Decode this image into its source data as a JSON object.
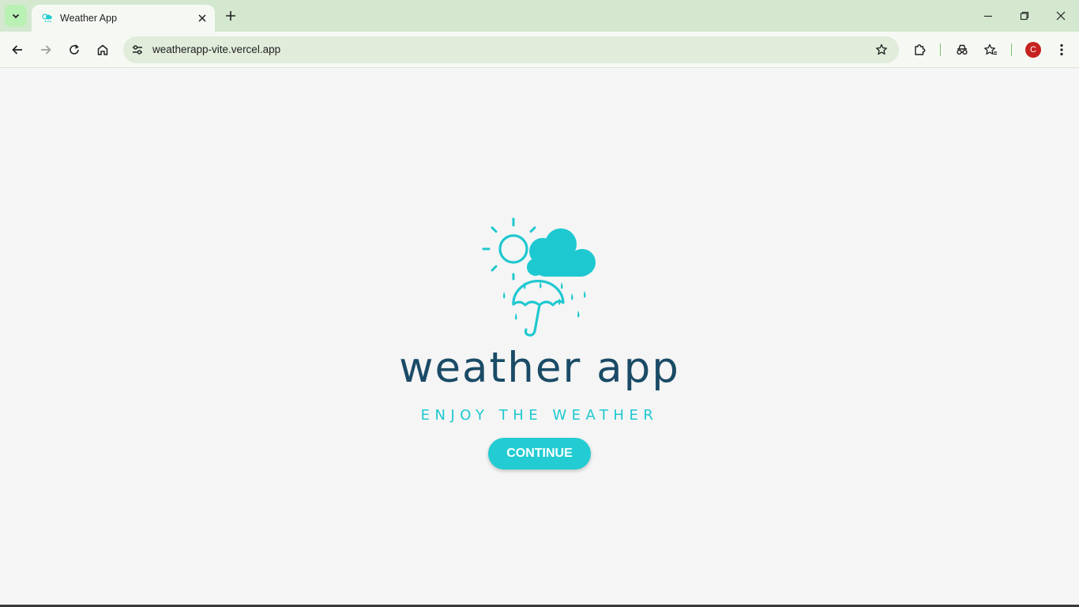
{
  "browser": {
    "tab_title": "Weather App",
    "url": "weatherapp-vite.vercel.app",
    "profile_initial": "C"
  },
  "page": {
    "title": "weather app",
    "tagline": "ENJOY THE WEATHER",
    "continue_label": "CONTINUE"
  },
  "colors": {
    "accent": "#22ccd2",
    "title": "#1a4b66",
    "tabstrip": "#d3e8cf",
    "toolbar": "#f6f9f3",
    "omnibox": "#e1ecdb",
    "page_bg": "#f5f5f5"
  },
  "icons": {
    "tab_search": "chevron-down-icon",
    "tab_close": "close-icon",
    "new_tab": "plus-icon",
    "back": "arrow-left-icon",
    "forward": "arrow-right-icon",
    "reload": "reload-icon",
    "home": "home-icon",
    "site_info": "tune-icon",
    "bookmark": "star-icon",
    "extensions": "puzzle-icon",
    "incognito": "incognito-icon",
    "reading_list": "star-list-icon",
    "menu": "kebab-menu-icon",
    "minimize": "minimize-icon",
    "restore": "restore-icon",
    "close_window": "close-icon"
  }
}
